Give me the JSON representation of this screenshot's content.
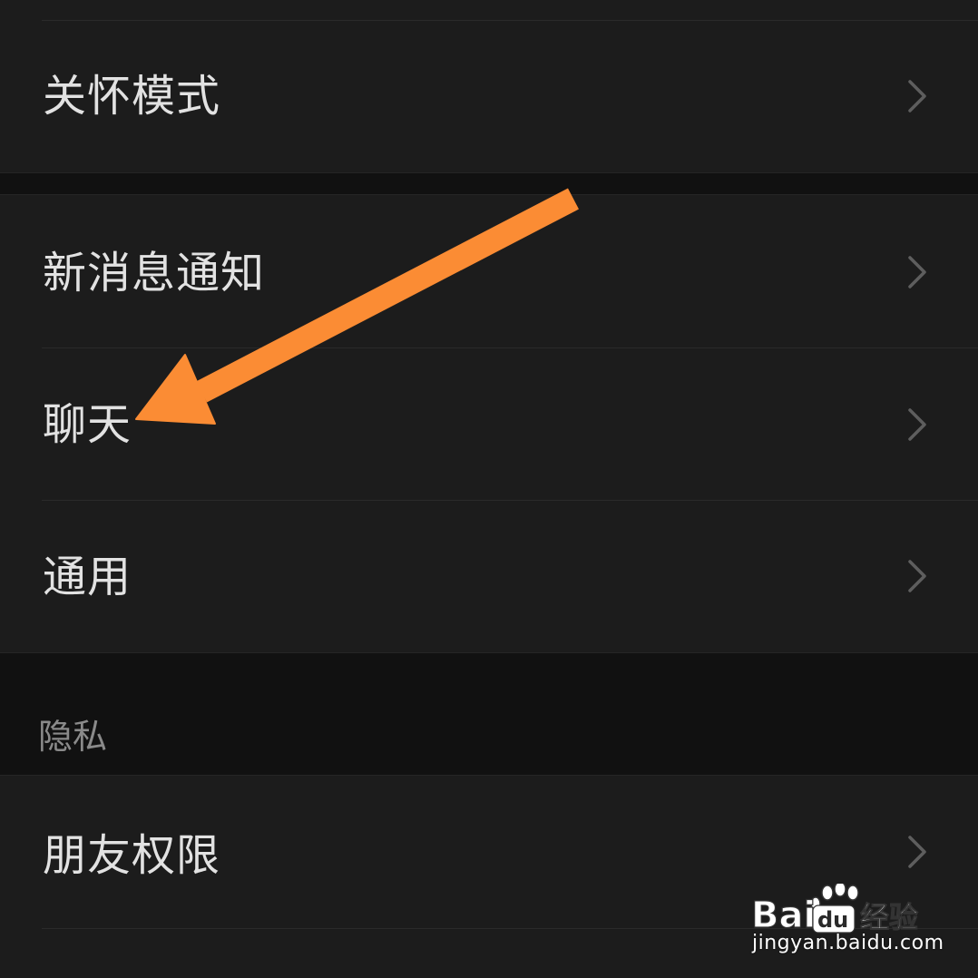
{
  "settings": {
    "rows": [
      {
        "label": "关怀模式"
      },
      {
        "label": "新消息通知"
      },
      {
        "label": "聊天"
      },
      {
        "label": "通用"
      },
      {
        "label": "朋友权限"
      }
    ],
    "privacy_header": "隐私"
  },
  "watermark": {
    "brand": "Bai",
    "brand_suffix": "经验",
    "url": "jingyan.baidu.com"
  },
  "colors": {
    "background": "#111111",
    "row_background": "#1c1c1c",
    "text": "#e2e2e2",
    "section_header": "#8a8a8a",
    "chevron": "#5e5e5e",
    "annotation_arrow": "#fb8c34"
  },
  "icons": {
    "chevron": "chevron-right-icon",
    "annotation": "arrow-annotation-icon",
    "watermark_logo": "baidu-paw-logo"
  }
}
